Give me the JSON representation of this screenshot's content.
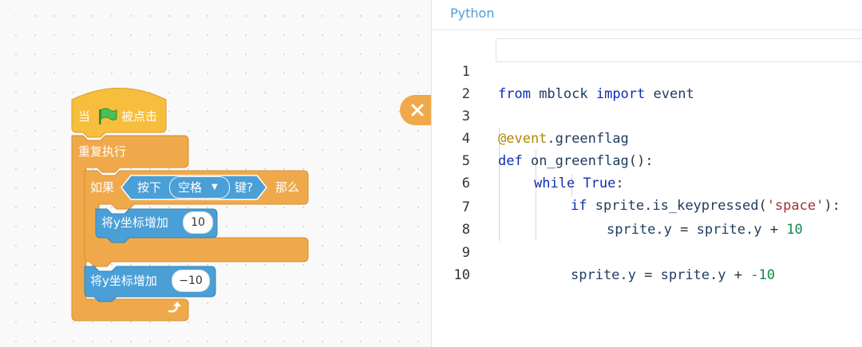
{
  "workspace": {
    "hat_when": "当",
    "hat_clicked": "被点击",
    "forever_label": "重复执行",
    "if_label": "如果",
    "key_pressed_prefix": "按下",
    "key_option": "空格",
    "key_pressed_suffix": "键?",
    "then_label": "那么",
    "change_y_label": "将y坐标增加",
    "change_y_value_1": "10",
    "change_y_value_2": "−10",
    "colors": {
      "events": "#f6be3c",
      "control": "#f0a94a",
      "motion": "#4a9fd6",
      "green_flag": "#4cbf56"
    }
  },
  "code_panel": {
    "tab_label": "Python",
    "line_numbers": [
      "1",
      "2",
      "3",
      "4",
      "5",
      "6",
      "7",
      "8",
      "9",
      "10"
    ],
    "lines": {
      "l1": {
        "kw1": "from",
        "mod": " mblock ",
        "kw2": "import",
        "name": " event"
      },
      "l3": {
        "dec": "@event",
        "rest": ".greenflag"
      },
      "l4": {
        "kw": "def",
        "name": " on_greenflag",
        "punc": "():"
      },
      "l5": {
        "kw": "while",
        "space": " ",
        "kw2": "True",
        "punc": ":"
      },
      "l6": {
        "kw": "if",
        "obj": " sprite.",
        "fn": "is_keypressed",
        "p1": "(",
        "str": "'space'",
        "p2": "):"
      },
      "l7": {
        "lhs": "sprite.y",
        "op": " = ",
        "rhs": "sprite.y",
        "op2": " + ",
        "num": "10"
      },
      "l9": {
        "lhs": "sprite.y",
        "op": " = ",
        "rhs": "sprite.y",
        "op2": " + ",
        "num": "-10"
      }
    }
  }
}
